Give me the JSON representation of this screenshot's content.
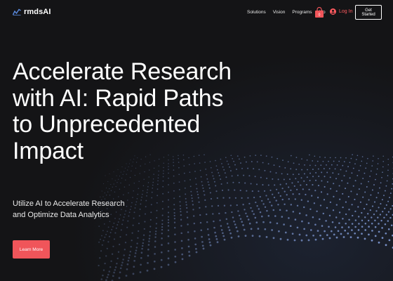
{
  "nav": {
    "logo_text": "rmdsAI",
    "links": [
      "Solutions",
      "Vision",
      "Programs",
      "Mo"
    ],
    "login_label": "Log In",
    "get_started_label": "Get Started"
  },
  "hero": {
    "title_lines": [
      "Accelerate Research",
      "with AI: Rapid Paths",
      "to Unprecedented",
      "Impact"
    ],
    "subtitle_lines": [
      "Utilize AI to Accelerate Research",
      "and Optimize Data Analytics"
    ],
    "cta_label": "Learn More"
  },
  "colors": {
    "background": "#141416",
    "accent": "#f0555a",
    "particles": "#8aa6e6"
  },
  "icons": [
    "chart-logo-icon",
    "shopping-bag-icon",
    "user-icon"
  ]
}
